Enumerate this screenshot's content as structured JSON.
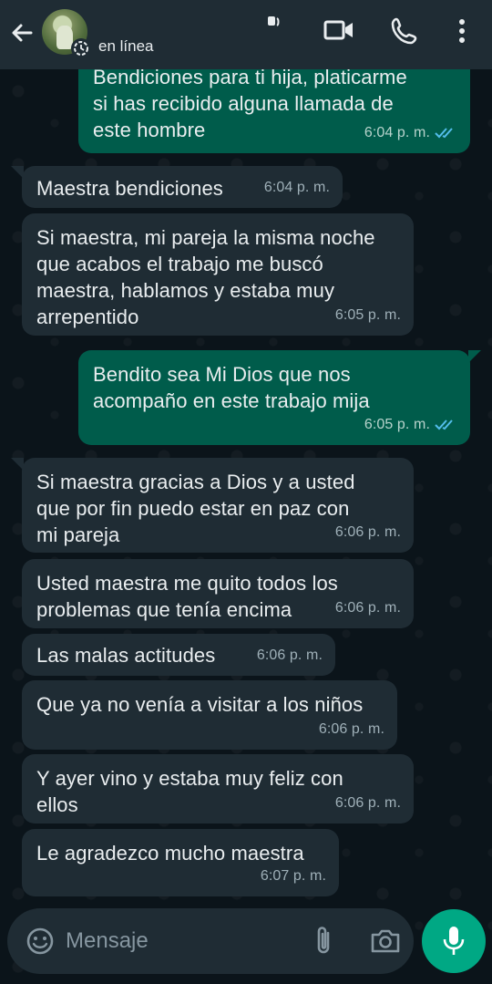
{
  "header": {
    "contact_status": "en línea"
  },
  "messages": [
    {
      "direction": "out",
      "text": "Bendiciones para ti hija, platicarme\nsi has recibido alguna llamada de\neste hombre",
      "time": "6:04 p. m.",
      "read": true
    },
    {
      "direction": "in",
      "text": "Maestra bendiciones",
      "time": "6:04 p. m."
    },
    {
      "direction": "in",
      "text": "Si maestra, mi pareja la misma noche\nque acabos el trabajo me buscó\nmaestra, hablamos y estaba muy\narrepentido",
      "time": "6:05 p. m."
    },
    {
      "direction": "out",
      "text": "Bendito sea Mi Dios que nos\nacompaño en este trabajo mija",
      "time": "6:05 p. m.",
      "read": true
    },
    {
      "direction": "in",
      "text": "Si maestra gracias a Dios y a usted\nque por fin puedo estar en paz con\nmi pareja",
      "time": "6:06 p. m."
    },
    {
      "direction": "in",
      "text": "Usted maestra me quito todos los\nproblemas que tenía encima",
      "time": "6:06 p. m."
    },
    {
      "direction": "in",
      "text": "Las malas actitudes",
      "time": "6:06 p. m."
    },
    {
      "direction": "in",
      "text": "Que ya no venía a visitar a los niños",
      "time": "6:06 p. m."
    },
    {
      "direction": "in",
      "text": "Y ayer vino y estaba muy feliz con\nellos",
      "time": "6:06 p. m."
    },
    {
      "direction": "in",
      "text": "Le agradezco mucho maestra",
      "time": "6:07 p. m."
    }
  ],
  "composer": {
    "placeholder": "Mensaje"
  },
  "icons": {
    "back": "back-arrow-icon",
    "video": "video-call-icon",
    "call": "phone-call-icon",
    "menu": "more-options-icon",
    "emoji": "emoji-icon",
    "attach": "paperclip-icon",
    "camera": "camera-icon",
    "mic": "microphone-icon"
  },
  "colors": {
    "background": "#0b141a",
    "header": "#1f2c34",
    "incoming_bubble": "#1f2c34",
    "outgoing_bubble": "#005c4b",
    "accent": "#00a884",
    "read_ticks": "#53bdeb"
  }
}
